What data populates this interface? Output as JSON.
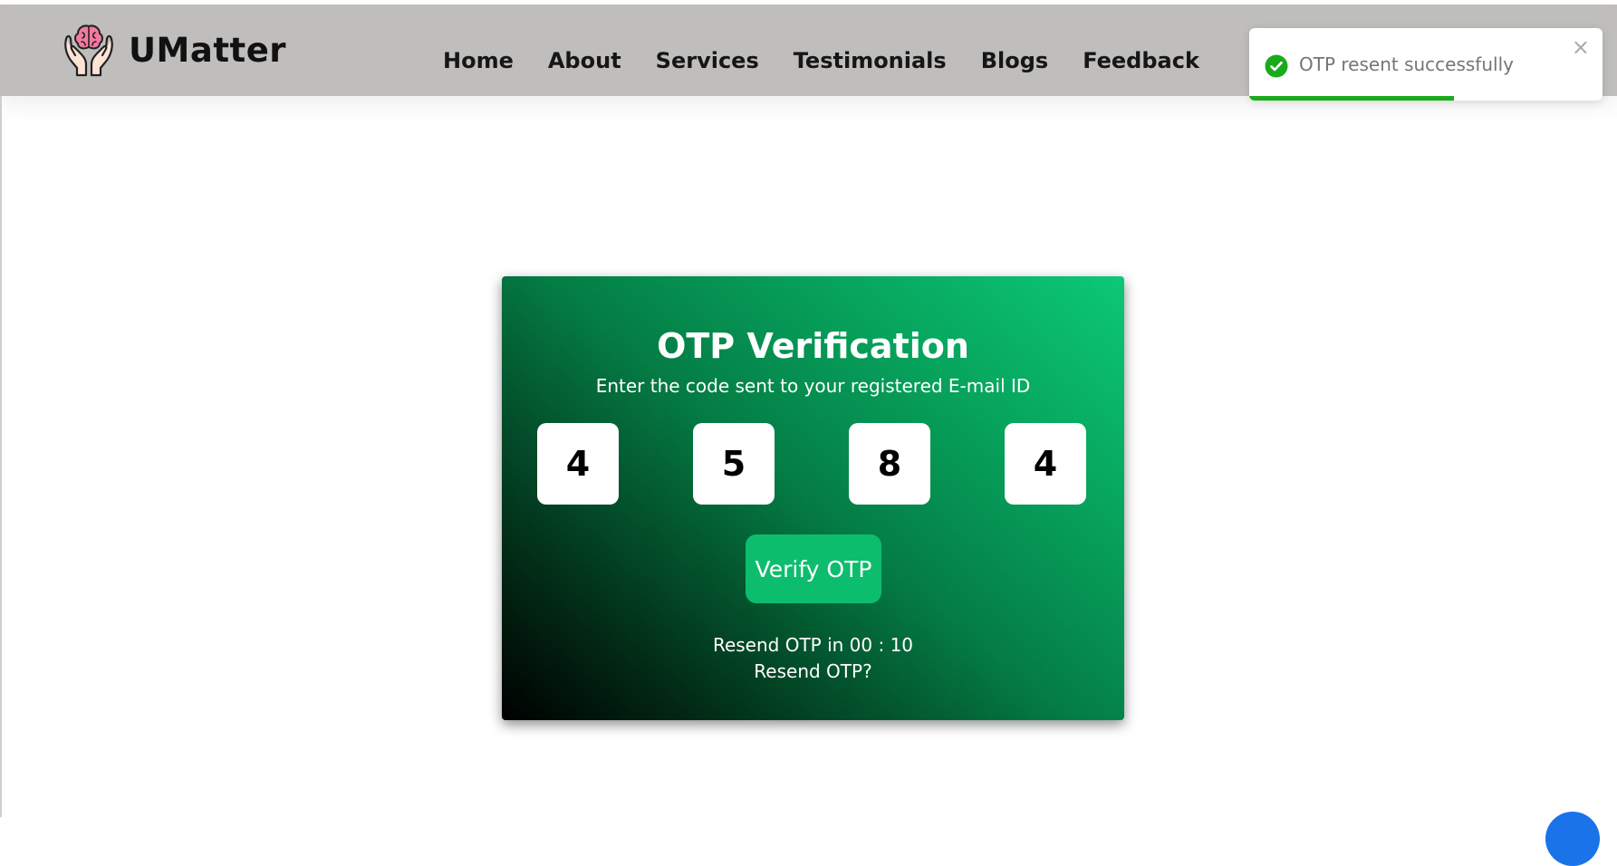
{
  "header": {
    "brand": "UMatter",
    "nav": [
      "Home",
      "About",
      "Services",
      "Testimonials",
      "Blogs",
      "Feedback"
    ]
  },
  "toast": {
    "message": "OTP resent successfully",
    "close_glyph": "×",
    "progress_fraction": 0.58,
    "accent_color": "#1aab1a"
  },
  "otp_card": {
    "title": "OTP Verification",
    "subtitle": "Enter the code sent to your registered E-mail ID",
    "digits": [
      "4",
      "5",
      "8",
      "4"
    ],
    "verify_label": "Verify OTP",
    "timer_text": "Resend OTP in 00 : 10",
    "resend_label": "Resend OTP?"
  },
  "colors": {
    "navbar_bg": "#bfbebc",
    "card_gradient_start": "#000000",
    "card_gradient_end": "#0cc877",
    "verify_button": "#0dbd6e"
  },
  "icons": {
    "logo": "hands-holding-brain-icon",
    "toast": "check-circle-icon",
    "close": "close-icon"
  }
}
